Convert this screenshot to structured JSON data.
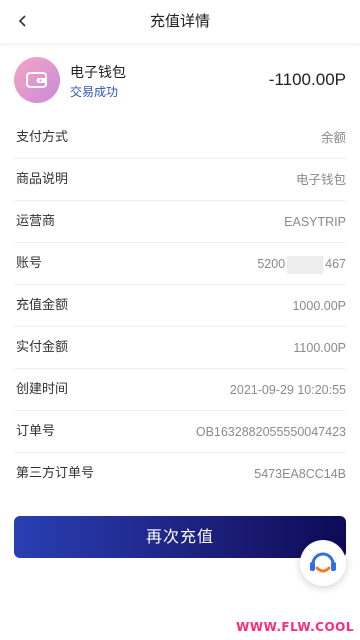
{
  "header": {
    "title": "充值详情",
    "back_icon": "chevron-left-icon"
  },
  "summary": {
    "icon": "wallet-icon",
    "name": "电子钱包",
    "status": "交易成功",
    "status_color": "#2d55b8",
    "amount": "-1100.00P"
  },
  "details": [
    {
      "label": "支付方式",
      "value": "余额"
    },
    {
      "label": "商品说明",
      "value": "电子钱包"
    },
    {
      "label": "运营商",
      "value": "EASYTRIP"
    },
    {
      "label": "账号",
      "value_prefix": "5200",
      "value_suffix": "467"
    },
    {
      "label": "充值金额",
      "value": "1000.00P"
    },
    {
      "label": "实付金额",
      "value": "1100.00P"
    },
    {
      "label": "创建时间",
      "value": "2021-09-29 10:20:55"
    },
    {
      "label": "订单号",
      "value": "OB1632882055550047423"
    },
    {
      "label": "第三方订单号",
      "value": "5473EA8CC14B"
    }
  ],
  "action": {
    "label": "再次充值",
    "color_start": "#2a3fb3",
    "color_end": "#0d0b56"
  },
  "floating": {
    "icon": "customer-service-icon"
  },
  "watermark": "WWW.FLW.COOL"
}
